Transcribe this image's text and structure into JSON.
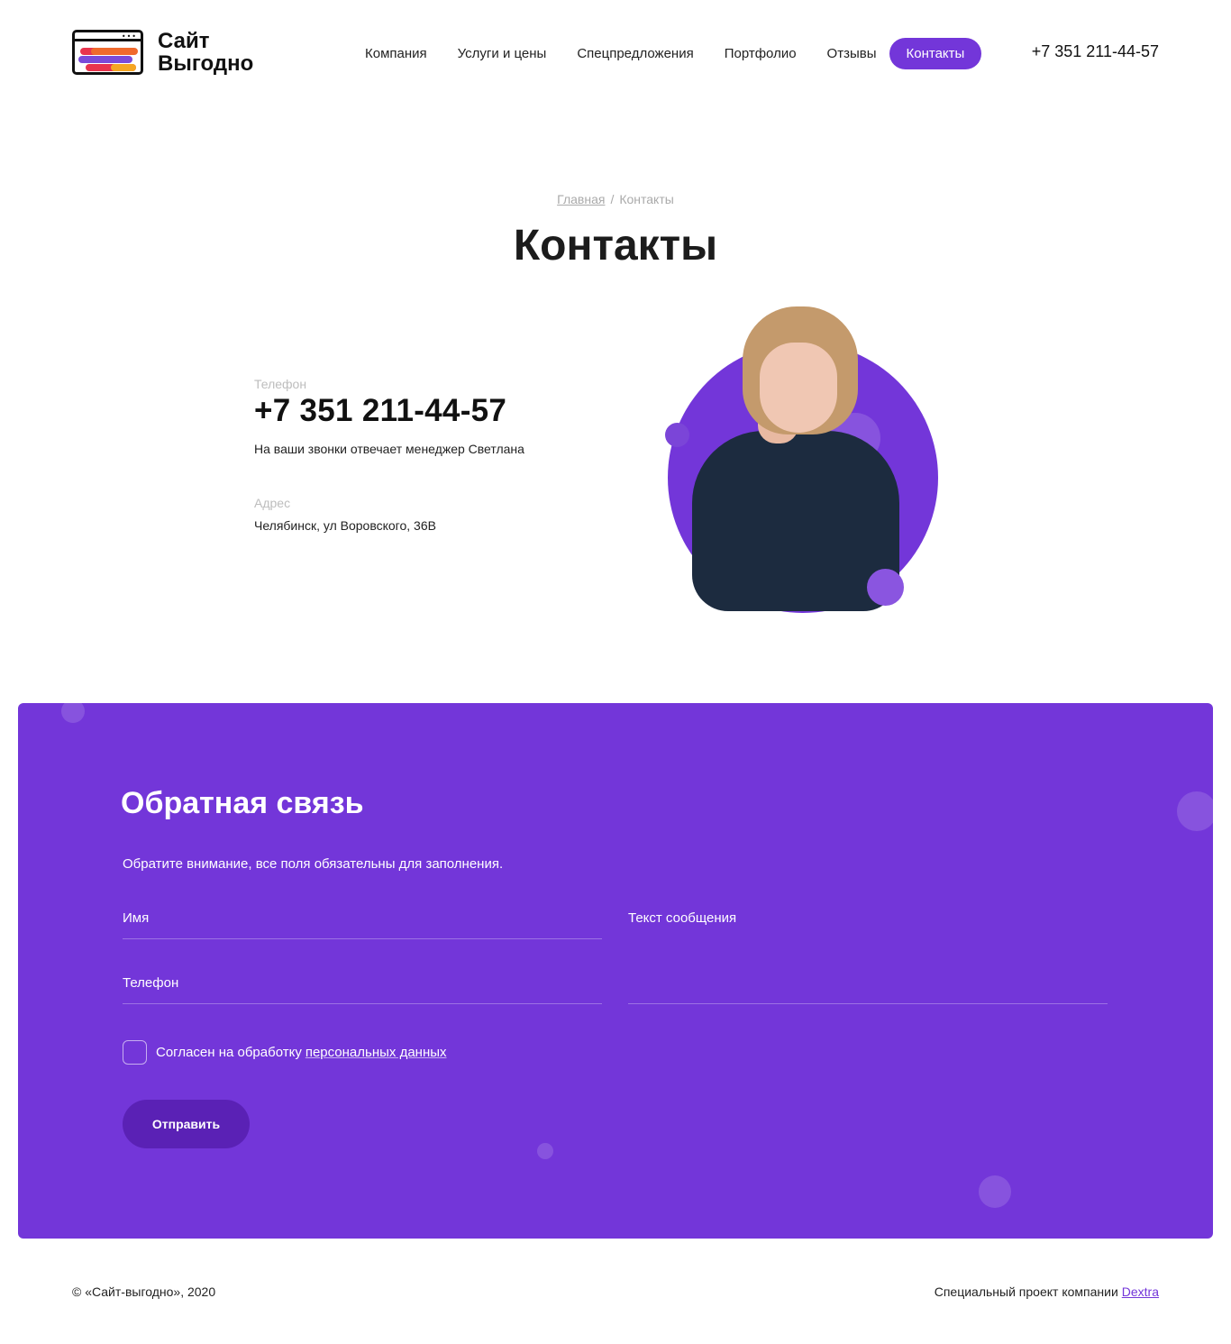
{
  "header": {
    "logo_line1": "Сайт",
    "logo_line2": "Выгодно",
    "logo_dots": "•••",
    "nav": [
      "Компания",
      "Услуги и цены",
      "Спецпредложения",
      "Портфолио",
      "Отзывы",
      "Контакты"
    ],
    "active_nav": "Контакты",
    "phone": "+7 351 211-44-57"
  },
  "breadcrumb": {
    "home": "Главная",
    "separator": "/",
    "current": "Контакты"
  },
  "page_title": "Контакты",
  "contacts": {
    "phone_label": "Телефон",
    "phone": "+7 351 211-44-57",
    "phone_note": "На ваши звонки отвечает менеджер Светлана",
    "address_label": "Адрес",
    "address": "Челябинск, ул Воровского, 36В"
  },
  "feedback": {
    "title": "Обратная связь",
    "note": "Обратите внимание, все поля обязательны для заполнения.",
    "name_placeholder": "Имя",
    "phone_placeholder": "Телефон",
    "message_placeholder": "Текст сообщения",
    "agree_text": "Согласен на обработку",
    "agree_link": "персональных данных",
    "submit_label": "Отправить"
  },
  "footer": {
    "copyright": "© «Сайт-выгодно», 2020",
    "project_text": "Специальный проект компании",
    "project_link": "Dextra"
  },
  "colors": {
    "accent": "#7336d9",
    "button_dark": "#5a21b5",
    "text": "#111111"
  }
}
